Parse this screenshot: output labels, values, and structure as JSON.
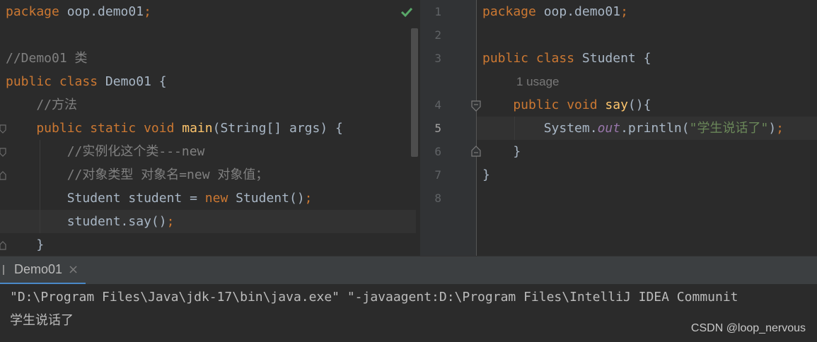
{
  "left_editor": {
    "lines": [
      [
        {
          "t": "package",
          "c": "kw"
        },
        {
          "t": " oop.demo01",
          "c": "id"
        },
        {
          "t": ";",
          "c": "kw"
        }
      ],
      [],
      [
        {
          "t": "//Demo01 类",
          "c": "cm"
        }
      ],
      [
        {
          "t": "public class ",
          "c": "kw"
        },
        {
          "t": "Demo01 {",
          "c": "id"
        }
      ],
      [
        {
          "t": "    //方法",
          "c": "cm"
        }
      ],
      [
        {
          "t": "    public static void ",
          "c": "kw"
        },
        {
          "t": "main",
          "c": "fn"
        },
        {
          "t": "(String[] args) {",
          "c": "id"
        }
      ],
      [
        {
          "t": "        //实例化这个类---new",
          "c": "cm"
        }
      ],
      [
        {
          "t": "        //对象类型 对象名=new 对象值；",
          "c": "cm"
        }
      ],
      [
        {
          "t": "        Student student = ",
          "c": "id"
        },
        {
          "t": "new ",
          "c": "kw"
        },
        {
          "t": "Student()",
          "c": "id"
        },
        {
          "t": ";",
          "c": "kw"
        }
      ],
      [
        {
          "t": "        student.say()",
          "c": "id"
        },
        {
          "t": ";",
          "c": "kw"
        }
      ],
      [
        {
          "t": "    }",
          "c": "id"
        }
      ]
    ],
    "highlight_line": 9,
    "status": "ok"
  },
  "right_editor": {
    "rows": [
      {
        "num": "1",
        "segs": [
          {
            "t": "package",
            "c": "kw"
          },
          {
            "t": " oop.demo01",
            "c": "id"
          },
          {
            "t": ";",
            "c": "kw"
          }
        ]
      },
      {
        "num": "2",
        "segs": []
      },
      {
        "num": "3",
        "segs": [
          {
            "t": "public class ",
            "c": "kw"
          },
          {
            "t": "Student {",
            "c": "id"
          }
        ]
      },
      {
        "num": "",
        "usage": "1 usage"
      },
      {
        "num": "4",
        "segs": [
          {
            "t": "    public void ",
            "c": "kw"
          },
          {
            "t": "say",
            "c": "fn"
          },
          {
            "t": "(){",
            "c": "id"
          }
        ]
      },
      {
        "num": "5",
        "segs": [
          {
            "t": "        System.",
            "c": "id"
          },
          {
            "t": "out",
            "c": "it"
          },
          {
            "t": ".println(",
            "c": "id"
          },
          {
            "t": "\"学生说话了\"",
            "c": "str"
          },
          {
            "t": ")",
            "c": "id"
          },
          {
            "t": ";",
            "c": "kw"
          }
        ]
      },
      {
        "num": "6",
        "segs": [
          {
            "t": "    }",
            "c": "id"
          }
        ]
      },
      {
        "num": "7",
        "segs": [
          {
            "t": "}",
            "c": "id"
          }
        ]
      },
      {
        "num": "8",
        "segs": []
      }
    ],
    "current_line": "5"
  },
  "run_panel": {
    "tab_label": "Demo01",
    "command": "\"D:\\Program Files\\Java\\jdk-17\\bin\\java.exe\" \"-javaagent:D:\\Program Files\\IntelliJ IDEA Communit",
    "output": "学生说话了"
  },
  "watermark": "CSDN @loop_nervous",
  "colors": {
    "keyword": "#cc7832",
    "identifier": "#a9b7c6",
    "comment": "#808080",
    "function": "#ffc66d",
    "string": "#6a8759",
    "field": "#9876aa",
    "check": "#59a869"
  }
}
